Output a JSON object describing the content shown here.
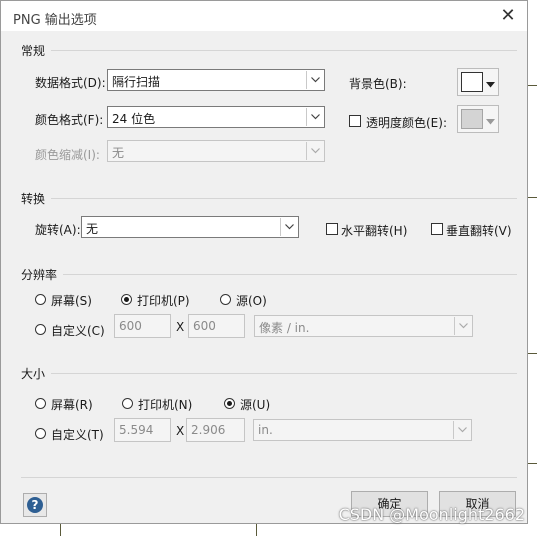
{
  "window": {
    "title": "PNG 输出选项",
    "close_symbol": "✕"
  },
  "general": {
    "heading": "常规",
    "data_format": {
      "label": "数据格式(D):",
      "value": "隔行扫描"
    },
    "color_format": {
      "label": "颜色格式(F):",
      "value": "24 位色"
    },
    "color_reduction": {
      "label": "颜色缩减(I):",
      "value": "无"
    },
    "background_color": {
      "label": "背景色(B):"
    },
    "transparency_color": {
      "label": "透明度颜色(E):"
    }
  },
  "transform": {
    "heading": "转换",
    "rotate": {
      "label": "旋转(A):",
      "value": "无"
    },
    "flip_horizontal": {
      "label": "水平翻转(H)"
    },
    "flip_vertical": {
      "label": "垂直翻转(V)"
    }
  },
  "resolution": {
    "heading": "分辨率",
    "screen": {
      "label": "屏幕(S)"
    },
    "printer": {
      "label": "打印机(P)"
    },
    "source": {
      "label": "源(O)"
    },
    "custom": {
      "label": "自定义(C)"
    },
    "width": "600",
    "height": "600",
    "times": "X",
    "unit": "像素 / in."
  },
  "size": {
    "heading": "大小",
    "screen": {
      "label": "屏幕(R)"
    },
    "printer": {
      "label": "打印机(N)"
    },
    "source": {
      "label": "源(U)"
    },
    "custom": {
      "label": "自定义(T)"
    },
    "width": "5.594",
    "height": "2.906",
    "times": "X",
    "unit": "in."
  },
  "footer": {
    "help": "?",
    "ok": "确定",
    "cancel": "取消"
  },
  "watermark": "CSDN @Moonlight2662"
}
